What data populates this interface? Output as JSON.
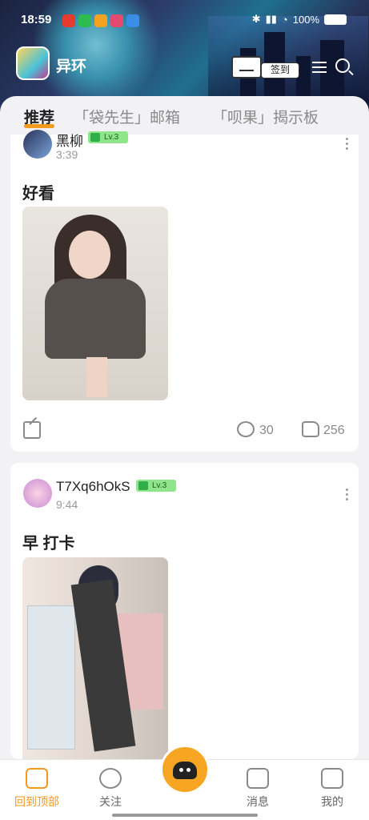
{
  "status_bar": {
    "time": "18:59",
    "battery": "100%"
  },
  "app": {
    "name": "异环",
    "signin_label": "签到"
  },
  "tabs": [
    {
      "label": "推荐"
    },
    {
      "label": "「袋先生」邮箱"
    },
    {
      "label": "「呗果」揭示板"
    }
  ],
  "posts": [
    {
      "username": "黑柳",
      "level": "Lv.3",
      "time": "3:39",
      "title": "好看",
      "comments": "30",
      "likes": "256"
    },
    {
      "username": "T7Xq6hOkS",
      "level": "Lv.3",
      "time": "9:44",
      "title": "早 打卡"
    }
  ],
  "bottom_nav": [
    {
      "label": "回到顶部"
    },
    {
      "label": "关注"
    },
    {
      "label": "消息"
    },
    {
      "label": "我的"
    }
  ],
  "colors": {
    "accent": "#f39a1e",
    "level_badge": "#8ee58a"
  },
  "icons": [
    "signin-icon",
    "menu-icon",
    "search-icon",
    "more-icon",
    "share-icon",
    "comment-icon",
    "like-icon",
    "home-icon",
    "follow-icon",
    "message-icon",
    "profile-icon"
  ]
}
